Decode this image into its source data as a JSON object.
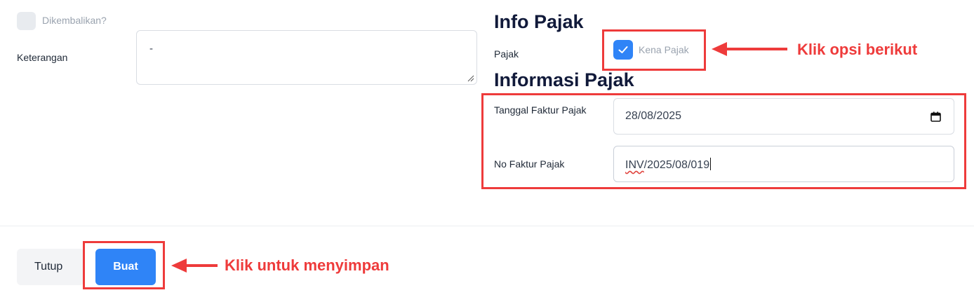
{
  "left": {
    "returned_label": "Dikembalikan?",
    "returned_checked": false,
    "note_label": "Keterangan",
    "note_value": "-"
  },
  "right": {
    "info_heading": "Info Pajak",
    "tax_label": "Pajak",
    "tax_option_label": "Kena Pajak",
    "tax_checked": true,
    "tax_info_heading": "Informasi Pajak",
    "invoice_date_label": "Tanggal Faktur Pajak",
    "invoice_date_value": "28/08/2025",
    "invoice_no_label": "No Faktur Pajak",
    "invoice_no_value_prefix": "INV",
    "invoice_no_value_rest": "/2025/08/019"
  },
  "footer": {
    "close_label": "Tutup",
    "create_label": "Buat"
  },
  "annotations": {
    "tax_option_hint": "Klik opsi berikut",
    "save_hint": "Klik untuk menyimpan"
  },
  "colors": {
    "accent": "#2f84f7",
    "annotation": "#ee3b3b",
    "heading": "#111a3a"
  }
}
